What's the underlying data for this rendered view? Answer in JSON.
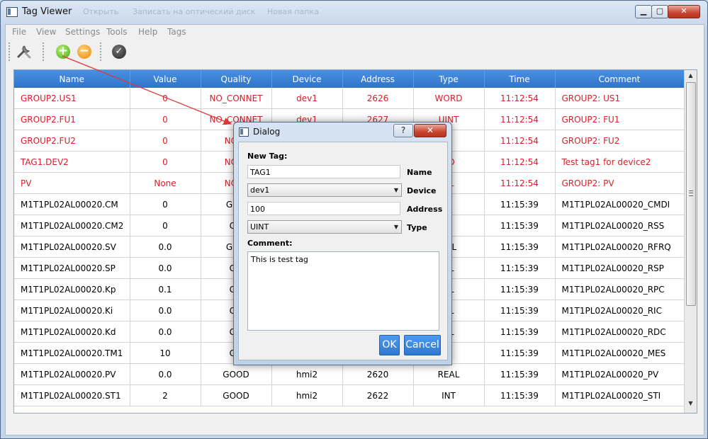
{
  "window": {
    "title": "Tag Viewer",
    "min_glyph": "▁",
    "max_glyph": "▢",
    "close_glyph": "✕",
    "background_tabs": [
      "Открыть",
      "Записать на оптический диск",
      "Новая папка"
    ]
  },
  "menu": [
    "File",
    "View",
    "Settings",
    "Tools",
    "Help",
    "Tags"
  ],
  "toolbar": {
    "buttons": [
      {
        "name": "settings-tools-icon",
        "glyph": ""
      },
      {
        "name": "add-tag-icon",
        "glyph": "+"
      },
      {
        "name": "remove-tag-icon",
        "glyph": "−"
      },
      {
        "name": "apply-check-icon",
        "glyph": "✓"
      }
    ]
  },
  "table": {
    "columns": [
      "Name",
      "Value",
      "Quality",
      "Device",
      "Address",
      "Type",
      "Time",
      "Comment"
    ],
    "rows": [
      {
        "red": true,
        "cells": [
          "GROUP2.US1",
          "0",
          "NO_CONNET",
          "dev1",
          "2626",
          "WORD",
          "11:12:54",
          "GROUP2: US1"
        ]
      },
      {
        "red": true,
        "cells": [
          "GROUP2.FU1",
          "0",
          "NO_CONNET",
          "dev1",
          "2627",
          "UINT",
          "11:12:54",
          "GROUP2: FU1"
        ]
      },
      {
        "red": true,
        "cells": [
          "GROUP2.FU2",
          "0",
          "NO_C",
          "",
          "",
          "T",
          "11:12:54",
          "GROUP2: FU2"
        ]
      },
      {
        "red": true,
        "cells": [
          "TAG1.DEV2",
          "0",
          "NO_C",
          "",
          "",
          "RD",
          "11:12:54",
          "Test tag1 for device2"
        ]
      },
      {
        "red": true,
        "cells": [
          "PV",
          "None",
          "NO_C",
          "",
          "",
          "AL",
          "11:12:54",
          "GROUP2: PV"
        ]
      },
      {
        "red": false,
        "cells": [
          "M1T1PL02AL00020.CM",
          "0",
          "GOO",
          "",
          "",
          "T",
          "11:15:39",
          "M1T1PL02AL00020_CMDI"
        ]
      },
      {
        "red": false,
        "cells": [
          "M1T1PL02AL00020.CM2",
          "0",
          "GO",
          "",
          "",
          "T",
          "11:15:39",
          "M1T1PL02AL00020_RSS"
        ]
      },
      {
        "red": false,
        "cells": [
          "M1T1PL02AL00020.SV",
          "0.0",
          "GOO",
          "",
          "",
          "EAL",
          "11:15:39",
          "M1T1PL02AL00020_RFRQ"
        ]
      },
      {
        "red": false,
        "cells": [
          "M1T1PL02AL00020.SP",
          "0.0",
          "GO",
          "",
          "",
          "AL",
          "11:15:39",
          "M1T1PL02AL00020_RSP"
        ]
      },
      {
        "red": false,
        "cells": [
          "M1T1PL02AL00020.Kp",
          "0.1",
          "GO",
          "",
          "",
          "AL",
          "11:15:39",
          "M1T1PL02AL00020_RPC"
        ]
      },
      {
        "red": false,
        "cells": [
          "M1T1PL02AL00020.Ki",
          "0.0",
          "GO",
          "",
          "",
          "AL",
          "11:15:39",
          "M1T1PL02AL00020_RIC"
        ]
      },
      {
        "red": false,
        "cells": [
          "M1T1PL02AL00020.Kd",
          "0.0",
          "GO",
          "",
          "",
          "AL",
          "11:15:39",
          "M1T1PL02AL00020_RDC"
        ]
      },
      {
        "red": false,
        "cells": [
          "M1T1PL02AL00020.TM1",
          "10",
          "GO",
          "",
          "",
          "T",
          "11:15:39",
          "M1T1PL02AL00020_MES"
        ]
      },
      {
        "red": false,
        "cells": [
          "M1T1PL02AL00020.PV",
          "0.0",
          "GOOD",
          "hmi2",
          "2620",
          "REAL",
          "11:15:39",
          "M1T1PL02AL00020_PV"
        ]
      },
      {
        "red": false,
        "cells": [
          "M1T1PL02AL00020.ST1",
          "2",
          "GOOD",
          "hmi2",
          "2622",
          "INT",
          "11:15:39",
          "M1T1PL02AL00020_STI"
        ]
      }
    ]
  },
  "scrollbar": {
    "up_glyph": "▲",
    "down_glyph": "▼",
    "grip_glyph": "≡"
  },
  "dialog": {
    "title": "Dialog",
    "help_glyph": "?",
    "close_glyph": "✕",
    "section_label": "New Tag:",
    "name_value": "TAG1",
    "name_label": "Name",
    "device_value": "dev1",
    "device_label": "Device",
    "address_value": "100",
    "address_label": "Address",
    "type_value": "UINT",
    "type_label": "Type",
    "comment_label": "Comment:",
    "comment_value": "This is test tag",
    "ok_label": "OK",
    "cancel_label": "Cancel"
  },
  "colors": {
    "header_blue": "#3680d8",
    "error_red": "#d6202a",
    "arrow_red": "#e0393b"
  }
}
